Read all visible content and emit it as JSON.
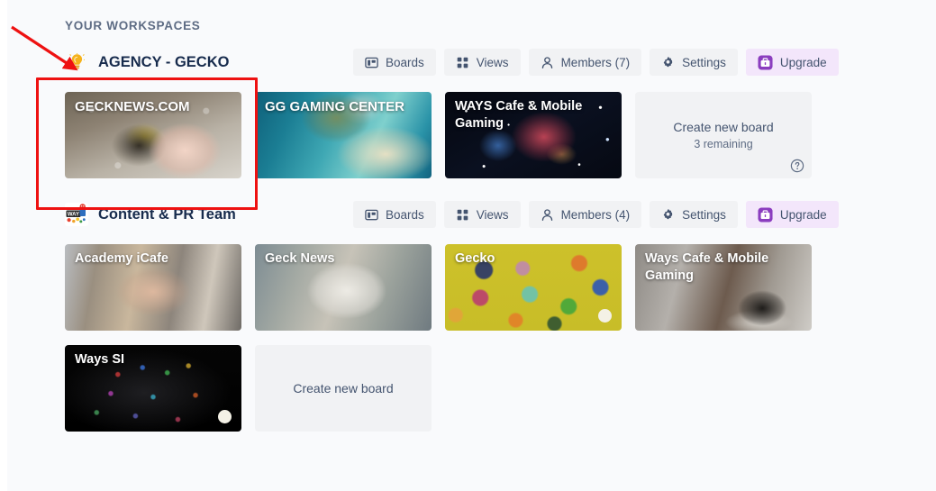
{
  "section": {
    "title": "YOUR WORKSPACES"
  },
  "icons": {
    "boards": "boards-icon",
    "views": "views-grid-icon",
    "members": "person-icon",
    "settings": "gear-icon",
    "upgrade": "briefcase-icon",
    "help": "help-circle-icon",
    "bulb": "lightbulb-icon",
    "annotation_arrow": "red-arrow-icon",
    "annotation_rect": "red-highlight-rectangle"
  },
  "colors": {
    "page_background": "#f9fafc",
    "button_background": "#f1f2f4",
    "button_text": "#44546f",
    "upgrade_background": "#f3e6fb",
    "upgrade_icon": "#8b3dbf",
    "heading_text": "#5e6c84",
    "workspace_name_text": "#172b4d",
    "annotation_red": "#ee1111",
    "tile_placeholder": "#f1f2f4"
  },
  "workspaces": [
    {
      "name": "AGENCY - GECKO",
      "avatar_type": "emoji",
      "avatar_glyph": "💡",
      "actions": [
        {
          "label": "Boards",
          "icon": "boards-icon",
          "variant": "default"
        },
        {
          "label": "Views",
          "icon": "views-grid-icon",
          "variant": "default"
        },
        {
          "label": "Members (7)",
          "icon": "person-icon",
          "variant": "default"
        },
        {
          "label": "Settings",
          "icon": "gear-icon",
          "variant": "default"
        },
        {
          "label": "Upgrade",
          "icon": "briefcase-icon",
          "variant": "upgrade"
        }
      ],
      "boards": [
        {
          "title": "GECKNEWS.COM",
          "style": "img-birdhand",
          "caps": true,
          "dot": false
        },
        {
          "title": "GG GAMING CENTER",
          "style": "img-island",
          "caps": true,
          "dot": false
        },
        {
          "title": "WAYS Cafe & Mobile Gaming",
          "style": "img-nebula",
          "caps": false,
          "dot": false
        }
      ],
      "create_tile": {
        "label": "Create new board",
        "sublabel": "3 remaining",
        "has_help": true
      }
    },
    {
      "name": "Content & PR Team",
      "avatar_type": "logo",
      "avatar_glyph": "",
      "actions": [
        {
          "label": "Boards",
          "icon": "boards-icon",
          "variant": "default"
        },
        {
          "label": "Views",
          "icon": "views-grid-icon",
          "variant": "default"
        },
        {
          "label": "Members (4)",
          "icon": "person-icon",
          "variant": "default"
        },
        {
          "label": "Settings",
          "icon": "gear-icon",
          "variant": "default"
        },
        {
          "label": "Upgrade",
          "icon": "briefcase-icon",
          "variant": "upgrade"
        }
      ],
      "boards": [
        {
          "title": "Academy iCafe",
          "style": "img-desk",
          "caps": false,
          "dot": false
        },
        {
          "title": "Geck News",
          "style": "img-news",
          "caps": false,
          "dot": false
        },
        {
          "title": "Gecko",
          "style": "img-dino",
          "caps": false,
          "dot": true
        },
        {
          "title": "Ways Cafe & Mobile Gaming",
          "style": "img-cafe",
          "caps": false,
          "dot": false
        },
        {
          "title": "Ways SI",
          "style": "img-keyboard",
          "caps": false,
          "dot": true
        }
      ],
      "create_tile": {
        "label": "Create new board",
        "sublabel": "",
        "has_help": false
      }
    }
  ]
}
